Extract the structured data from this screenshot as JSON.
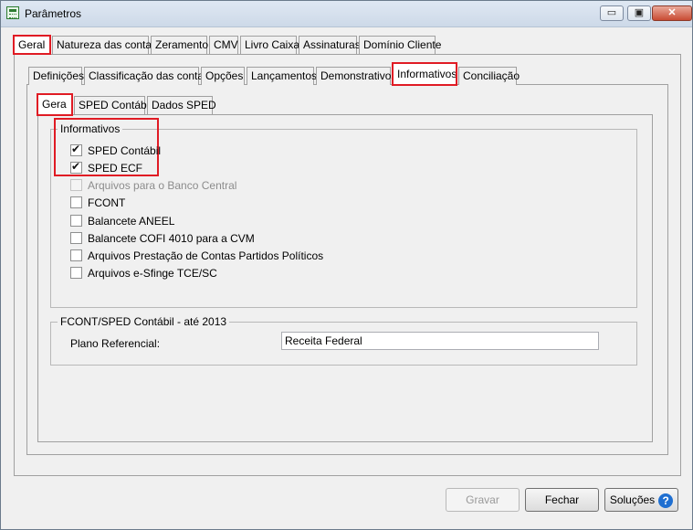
{
  "window": {
    "title": "Parâmetros",
    "minimize": "▭",
    "maximize": "▣",
    "close": "✕"
  },
  "main_tabs": [
    "Geral",
    "Natureza das contas",
    "Zeramento",
    "CMV",
    "Livro Caixa",
    "Assinaturas",
    "Domínio Cliente"
  ],
  "sub_tabs": [
    "Definições",
    "Classificação das contas",
    "Opções",
    "Lançamentos",
    "Demonstrativos",
    "Informativos",
    "Conciliação"
  ],
  "inner_tabs": [
    "Gera",
    "SPED Contábil",
    "Dados SPED"
  ],
  "informativos": {
    "legend": "Informativos",
    "items": [
      {
        "label": "SPED Contábil",
        "checked": true
      },
      {
        "label": "SPED ECF",
        "checked": true
      },
      {
        "label": "Arquivos para o Banco Central",
        "checked": false
      },
      {
        "label": "FCONT",
        "checked": false
      },
      {
        "label": "Balancete ANEEL",
        "checked": false
      },
      {
        "label": "Balancete COFI 4010 para a CVM",
        "checked": false
      },
      {
        "label": "Arquivos Prestação de Contas Partidos Políticos",
        "checked": false
      },
      {
        "label": "Arquivos e-Sfinge TCE/SC",
        "checked": false
      }
    ]
  },
  "fcont": {
    "legend": "FCONT/SPED Contábil - até 2013",
    "plano_label": "Plano Referencial:",
    "plano_value": "Receita Federal"
  },
  "buttons": {
    "gravar": "Gravar",
    "fechar": "Fechar",
    "solucoes": "Soluções",
    "help": "?"
  }
}
